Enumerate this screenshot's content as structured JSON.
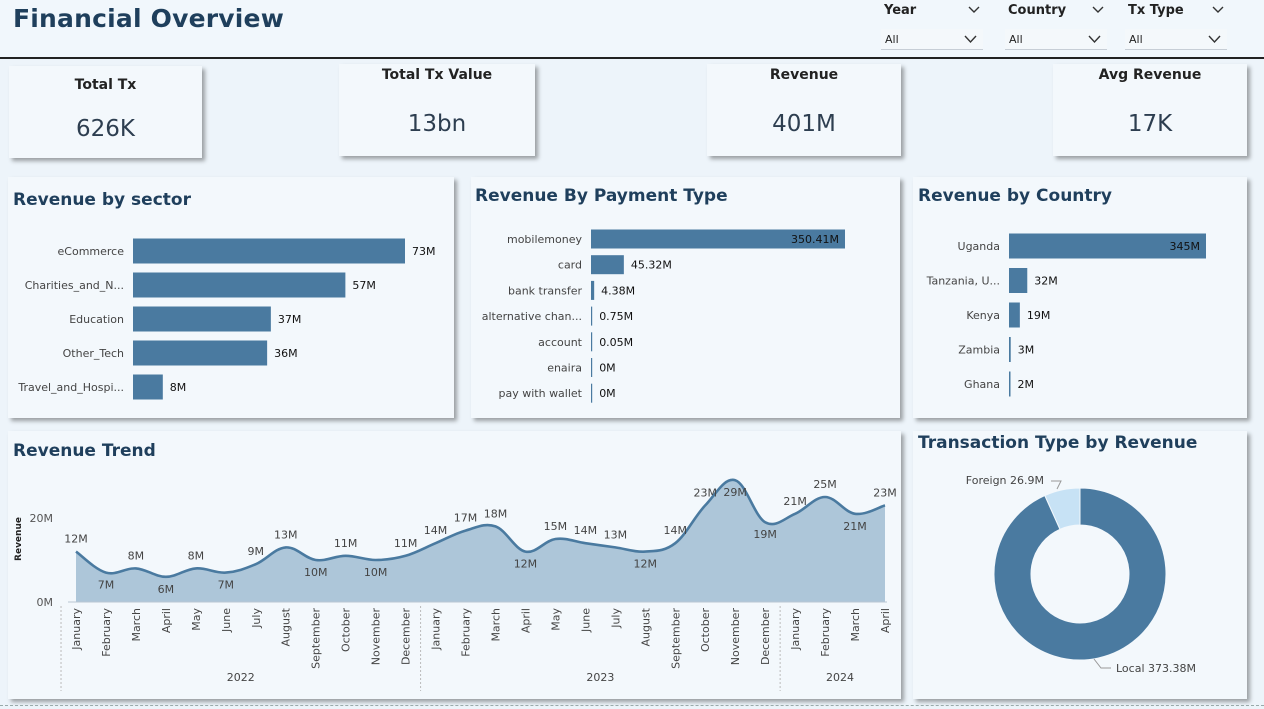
{
  "header": {
    "title": "Financial Overview"
  },
  "filters": [
    {
      "label": "Year",
      "value": "All"
    },
    {
      "label": "Country",
      "value": "All"
    },
    {
      "label": "Tx Type",
      "value": "All"
    }
  ],
  "kpis": [
    {
      "label": "Total Tx",
      "value": "626K"
    },
    {
      "label": "Total Tx Value",
      "value": "13bn"
    },
    {
      "label": "Revenue",
      "value": "401M"
    },
    {
      "label": "Avg Revenue",
      "value": "17K"
    }
  ],
  "colors": {
    "bar": "#4a7aa0",
    "area": "#adc6d9",
    "line": "#4a7aa0",
    "donut_local": "#4a7aa0",
    "donut_foreign": "#c7e2f5",
    "title": "#1f3f5c"
  },
  "chart_data": [
    {
      "type": "bar",
      "orientation": "horizontal",
      "title": "Revenue by sector",
      "categories": [
        "eCommerce",
        "Charities_and_N...",
        "Education",
        "Other_Tech",
        "Travel_and_Hospi..."
      ],
      "values": [
        73,
        57,
        37,
        36,
        8
      ],
      "data_labels": [
        "73M",
        "57M",
        "37M",
        "36M",
        "8M"
      ],
      "unit": "M"
    },
    {
      "type": "bar",
      "orientation": "horizontal",
      "title": "Revenue By Payment Type",
      "categories": [
        "mobilemoney",
        "card",
        "bank transfer",
        "alternative chan...",
        "account",
        "enaira",
        "pay with wallet"
      ],
      "values": [
        350.41,
        45.32,
        4.38,
        0.75,
        0.05,
        0,
        0
      ],
      "data_labels": [
        "350.41M",
        "45.32M",
        "4.38M",
        "0.75M",
        "0.05M",
        "0M",
        "0M"
      ],
      "unit": "M"
    },
    {
      "type": "bar",
      "orientation": "horizontal",
      "title": "Revenue by Country",
      "categories": [
        "Uganda",
        "Tanzania, U...",
        "Kenya",
        "Zambia",
        "Ghana"
      ],
      "values": [
        345,
        32,
        19,
        3,
        2
      ],
      "data_labels": [
        "345M",
        "32M",
        "19M",
        "3M",
        "2M"
      ],
      "unit": "M"
    },
    {
      "type": "area",
      "title": "Revenue Trend",
      "ylabel": "Revenue",
      "yticks": [
        "0M",
        "20M"
      ],
      "ylim": [
        0,
        30
      ],
      "x": [
        "January",
        "February",
        "March",
        "April",
        "May",
        "June",
        "July",
        "August",
        "September",
        "October",
        "November",
        "December",
        "January",
        "February",
        "March",
        "April",
        "May",
        "June",
        "July",
        "August",
        "September",
        "October",
        "November",
        "December",
        "January",
        "February",
        "March",
        "April"
      ],
      "years": [
        {
          "label": "2022",
          "start": 0,
          "end": 11
        },
        {
          "label": "2023",
          "start": 12,
          "end": 23
        },
        {
          "label": "2024",
          "start": 24,
          "end": 27
        }
      ],
      "values": [
        12,
        7,
        8,
        6,
        8,
        7,
        9,
        13,
        10,
        11,
        10,
        11,
        14,
        17,
        18,
        12,
        15,
        14,
        13,
        12,
        14,
        23,
        29,
        19,
        21,
        25,
        21,
        23
      ],
      "data_labels": [
        "12M",
        "7M",
        "8M",
        "6M",
        "8M",
        "7M",
        "9M",
        "13M",
        "10M",
        "11M",
        "10M",
        "11M",
        "14M",
        "17M",
        "18M",
        "12M",
        "15M",
        "14M",
        "13M",
        "12M",
        "14M",
        "23M",
        "29M",
        "19M",
        "21M",
        "25M",
        "21M",
        "23M"
      ]
    },
    {
      "type": "pie",
      "variant": "donut",
      "title": "Transaction Type by Revenue",
      "labels": [
        "Local",
        "Foreign"
      ],
      "values": [
        373.38,
        26.9
      ],
      "data_labels": [
        "Local 373.38M",
        "Foreign 26.9M"
      ]
    }
  ]
}
